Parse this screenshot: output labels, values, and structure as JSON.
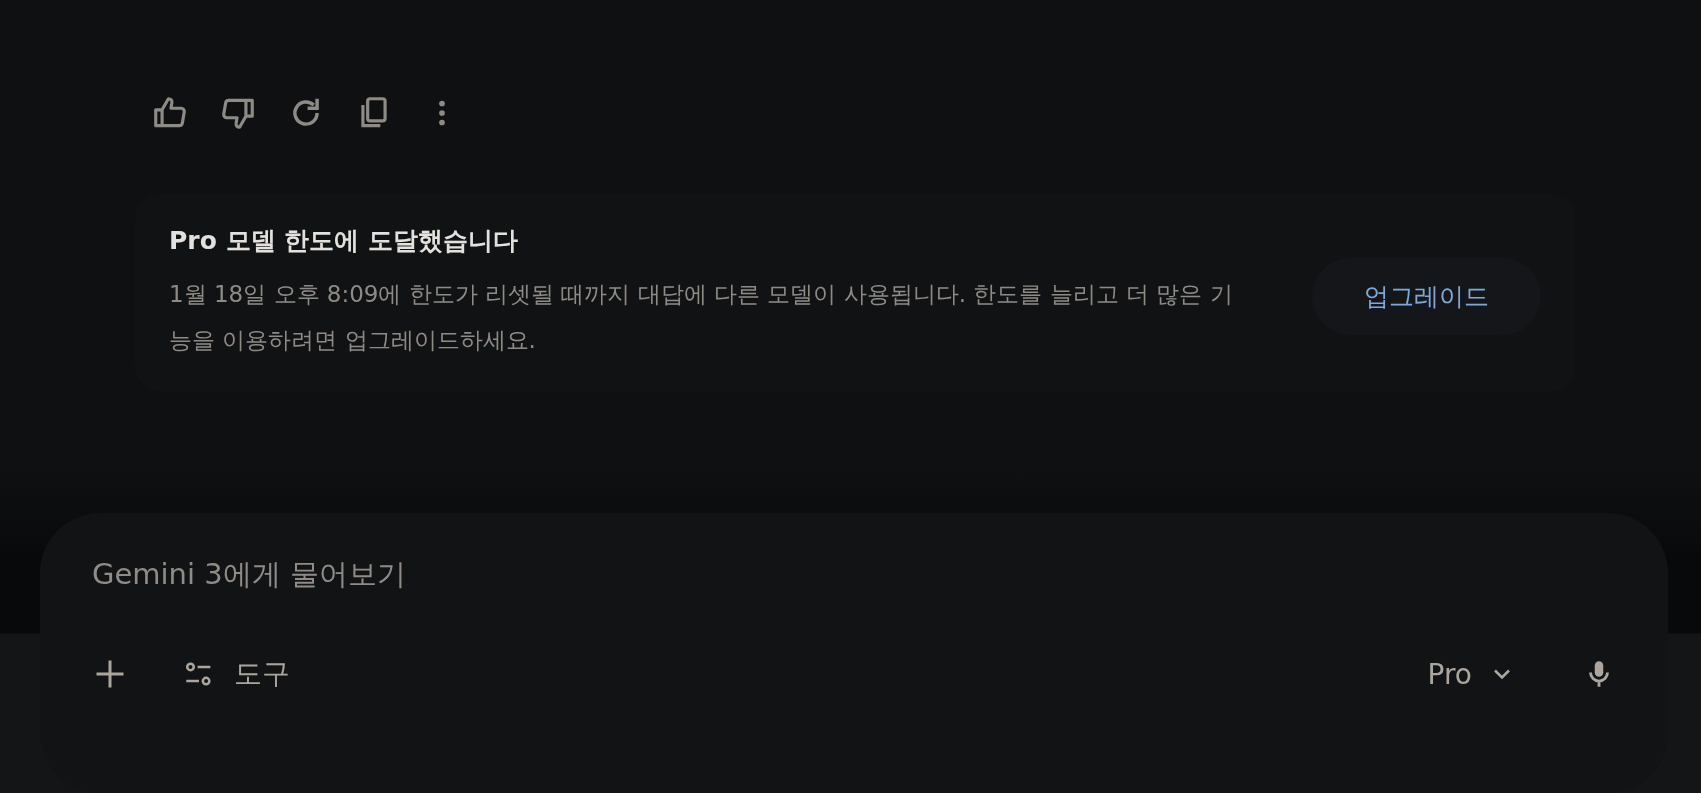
{
  "response_actions": [
    {
      "kind": "thumb-up"
    },
    {
      "kind": "thumb-down"
    },
    {
      "kind": "redo"
    },
    {
      "kind": "copy"
    },
    {
      "kind": "more"
    }
  ],
  "notice": {
    "title": "Pro 모델 한도에 도달했습니다",
    "body": "1월 18일 오후 8:09에 한도가 리셋될 때까지 대답에 다른 모델이 사용됩니다. 한도를 늘리고 더 많은 기능을 이용하려면 업그레이드하세요.",
    "button": "업그레이드"
  },
  "composer": {
    "placeholder": "Gemini 3에게 물어보기",
    "tools_label": "도구",
    "model": "Pro"
  }
}
